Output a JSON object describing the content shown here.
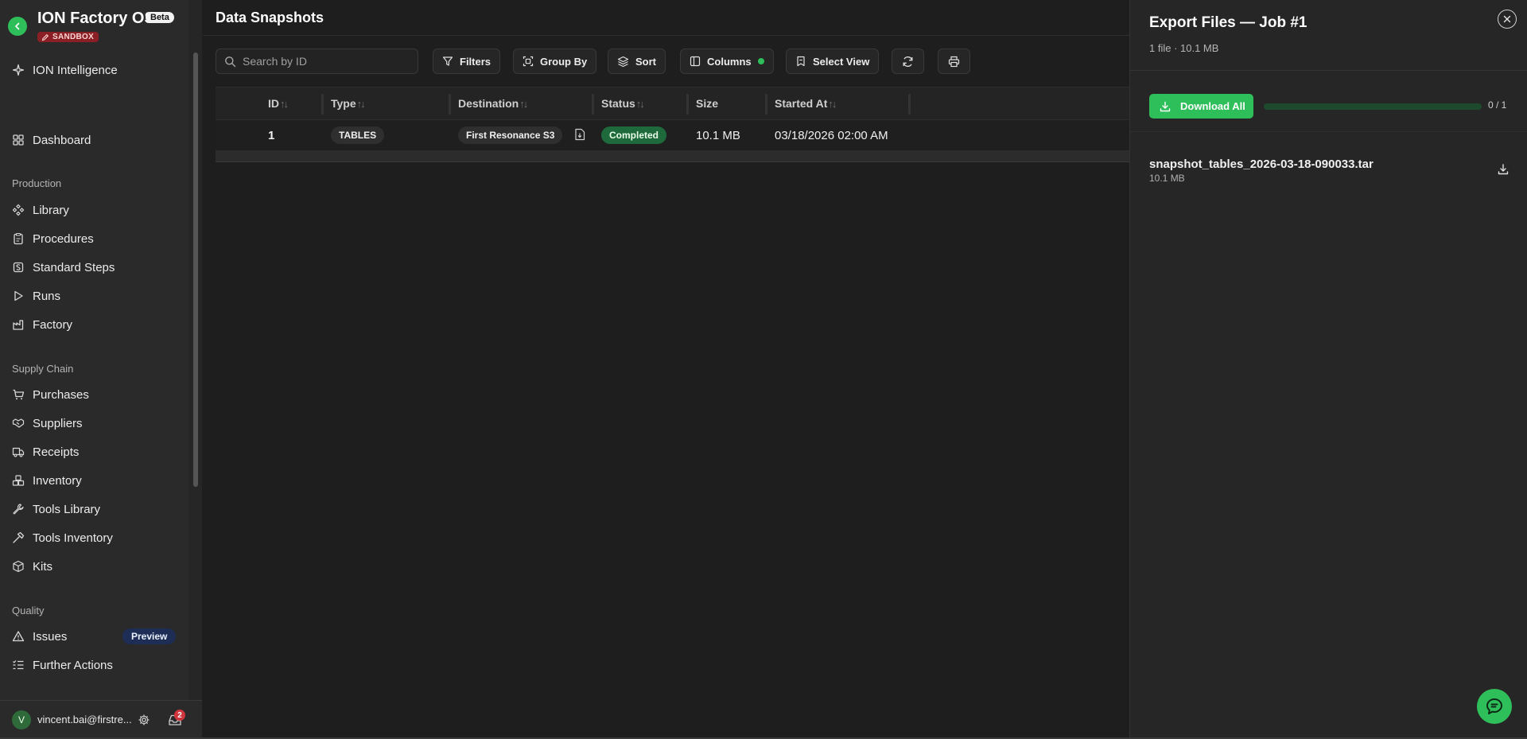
{
  "app": {
    "title": "ION Factory OS",
    "beta": "Beta",
    "sandbox": "SANDBOX"
  },
  "sidebar": {
    "intelligence": "ION Intelligence",
    "dashboard": "Dashboard",
    "production_heading": "Production",
    "production": [
      "Library",
      "Procedures",
      "Standard Steps",
      "Runs",
      "Factory"
    ],
    "supply_heading": "Supply Chain",
    "supply": [
      "Purchases",
      "Suppliers",
      "Receipts",
      "Inventory",
      "Tools Library",
      "Tools Inventory",
      "Kits"
    ],
    "quality_heading": "Quality",
    "quality": [
      "Issues",
      "Further Actions"
    ],
    "preview_badge": "Preview",
    "user_initial": "V",
    "user_email": "vincent.bai@firstre...",
    "inbox_count": "2"
  },
  "main": {
    "title": "Data Snapshots",
    "search_placeholder": "Search by ID",
    "toolbar": {
      "filters": "Filters",
      "group_by": "Group By",
      "sort": "Sort",
      "columns": "Columns",
      "select_view": "Select View"
    },
    "columns": [
      "ID",
      "Type",
      "Destination",
      "Status",
      "Size",
      "Started At"
    ],
    "sort_glyph": "↑↓",
    "rows": [
      {
        "id": "1",
        "type": "TABLES",
        "destination": "First Resonance S3",
        "status": "Completed",
        "size": "10.1 MB",
        "started_at": "03/18/2026 02:00 AM"
      }
    ]
  },
  "panel": {
    "title": "Export Files — Job #1",
    "subtitle": "1 file · 10.1 MB",
    "download_all": "Download All",
    "progress_label": "0 / 1",
    "progress_fraction": 0,
    "files": [
      {
        "name": "snapshot_tables_2026-03-18-090033.tar",
        "size": "10.1 MB"
      }
    ]
  },
  "colors": {
    "accent": "#2fbf5a",
    "sandbox": "#8a1f25",
    "status_completed": "#1e6a3d",
    "preview": "#1d2d55"
  }
}
